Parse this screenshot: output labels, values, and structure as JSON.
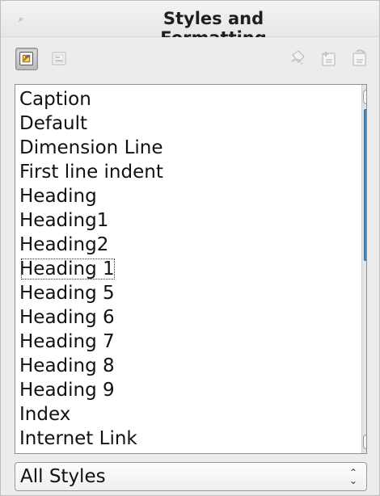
{
  "window": {
    "title": "Styles and Formatting"
  },
  "toolbar": {
    "buttons": [
      {
        "icon": "paragraph-styles-icon",
        "state": "selected"
      },
      {
        "icon": "frame-styles-icon",
        "state": "disabled"
      },
      {
        "icon": "fill-format-mode-icon",
        "state": "disabled"
      },
      {
        "icon": "new-style-from-selection-icon",
        "state": "disabled"
      },
      {
        "icon": "update-style-icon",
        "state": "disabled"
      }
    ]
  },
  "style_list": {
    "items": [
      {
        "label": "Caption"
      },
      {
        "label": "Default"
      },
      {
        "label": "Dimension Line"
      },
      {
        "label": "First line indent"
      },
      {
        "label": "Heading"
      },
      {
        "label": "Heading1"
      },
      {
        "label": "Heading2"
      },
      {
        "label": "Heading 1"
      },
      {
        "label": "Heading 5"
      },
      {
        "label": "Heading 6"
      },
      {
        "label": "Heading 7"
      },
      {
        "label": "Heading 8"
      },
      {
        "label": "Heading 9"
      },
      {
        "label": "Index"
      },
      {
        "label": "Internet Link"
      }
    ],
    "focused_item": "Heading 1"
  },
  "filter": {
    "selected": "All Styles"
  },
  "colors": {
    "scroll_thumb": "#4a8fd3",
    "active_button": "#c8c8c8",
    "panel_bg": "#ececec"
  }
}
